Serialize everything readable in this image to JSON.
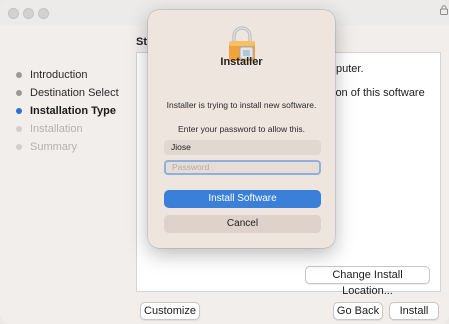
{
  "window": {
    "section_title": "St"
  },
  "sidebar": {
    "items": [
      {
        "label": "Introduction",
        "state": "done"
      },
      {
        "label": "Destination Select",
        "state": "done"
      },
      {
        "label": "Installation Type",
        "state": "active"
      },
      {
        "label": "Installation",
        "state": "disabled"
      },
      {
        "label": "Summary",
        "state": "disabled"
      }
    ]
  },
  "panel": {
    "text_line1": "puter.",
    "text_line2": "ion of this software",
    "change_location_label": "Change Install Location..."
  },
  "footer": {
    "customize_label": "Customize",
    "go_back_label": "Go Back",
    "install_label": "Install"
  },
  "dialog": {
    "title": "Installer",
    "message": "Installer is trying to install new software.",
    "prompt": "Enter your password to allow this.",
    "username_value": "Jiose",
    "password_placeholder": "Password",
    "install_button_label": "Install Software",
    "cancel_button_label": "Cancel",
    "icon": "padlock-icon"
  },
  "colors": {
    "accent": "#3a7fd8",
    "active_dot": "#2c6fd6"
  }
}
